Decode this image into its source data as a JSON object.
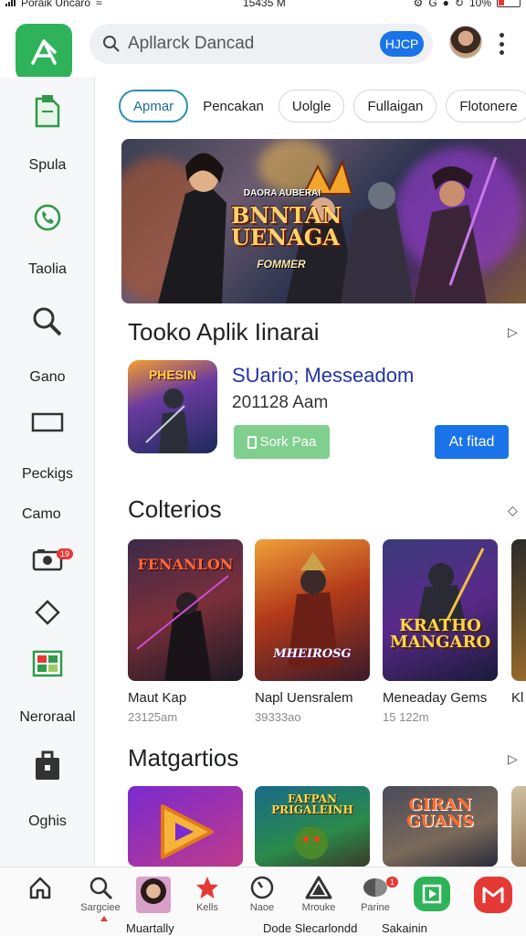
{
  "status": {
    "left": "Poraik Uncaro",
    "time": "15435 M",
    "battery": "10%"
  },
  "search": {
    "placeholder": "Apllarck Dancad",
    "pill": "HJCP"
  },
  "sidebar": {
    "items": [
      {
        "label": "Spula",
        "icon": "clipboard-icon"
      },
      {
        "label": "Taolia",
        "icon": "phone-icon"
      },
      {
        "label": "Gano",
        "icon": "magnifier-icon"
      },
      {
        "label": "Peckigs",
        "icon": "rectangle-icon"
      },
      {
        "label": "Camo",
        "icon": ""
      },
      {
        "label": "",
        "icon": "camera-icon",
        "badge": "19"
      },
      {
        "label": "",
        "icon": "diamond-icon"
      },
      {
        "label": "Neroraal",
        "icon": "grid-icon"
      },
      {
        "label": "Oghis",
        "icon": "briefcase-icon"
      }
    ]
  },
  "chips": [
    "Apmar",
    "Pencakan",
    "Uolgle",
    "Fullaigan",
    "Flotonere"
  ],
  "banner": {
    "top": "DAORA AUBERAI",
    "title": "BNNTAN UENAGA",
    "sub": "FOMMER"
  },
  "featured": {
    "section_title": "Tooko Aplik Iinarai",
    "icon_label": "PHESIN",
    "name": "SUario; Messeadom",
    "meta": "201128 Aam",
    "btn_green": "Sork Paa",
    "btn_blue": "At fitad"
  },
  "collections": {
    "title": "Colterios",
    "cards": [
      {
        "art": "FENANLON",
        "name": "Maut Kap",
        "sub": "23125am"
      },
      {
        "art": "MHEIROSG",
        "name": "Napl Uensralem",
        "sub": "39333ao"
      },
      {
        "art": "KRATHO MANGARO",
        "name": "Meneaday Gems",
        "sub": "15 122m"
      },
      {
        "art": "",
        "name": "Kl",
        "sub": ""
      }
    ]
  },
  "more": {
    "title": "Matgartios",
    "cards": [
      {
        "art": ""
      },
      {
        "art": "FAFPAN PRIGALEINH"
      },
      {
        "art": "GIRAN GUANS"
      }
    ]
  },
  "bottom_nav": {
    "items": [
      {
        "label": "",
        "icon": "home-icon"
      },
      {
        "label": "Sargciee",
        "icon": "search-icon"
      },
      {
        "label": "",
        "icon": "profile-avatar"
      },
      {
        "label": "Kells",
        "icon": "star-icon"
      },
      {
        "label": "Naoe",
        "icon": "clock-icon"
      },
      {
        "label": "Mrouke",
        "icon": "triangle-icon"
      },
      {
        "label": "Parine",
        "icon": "chat-icon",
        "badge": "1"
      },
      {
        "label": "",
        "icon": "play-icon"
      },
      {
        "label": "",
        "icon": "gmail-icon"
      }
    ],
    "bottom_text": [
      "Muartally",
      "Dode Slecarlondd",
      "Sakainin"
    ]
  }
}
